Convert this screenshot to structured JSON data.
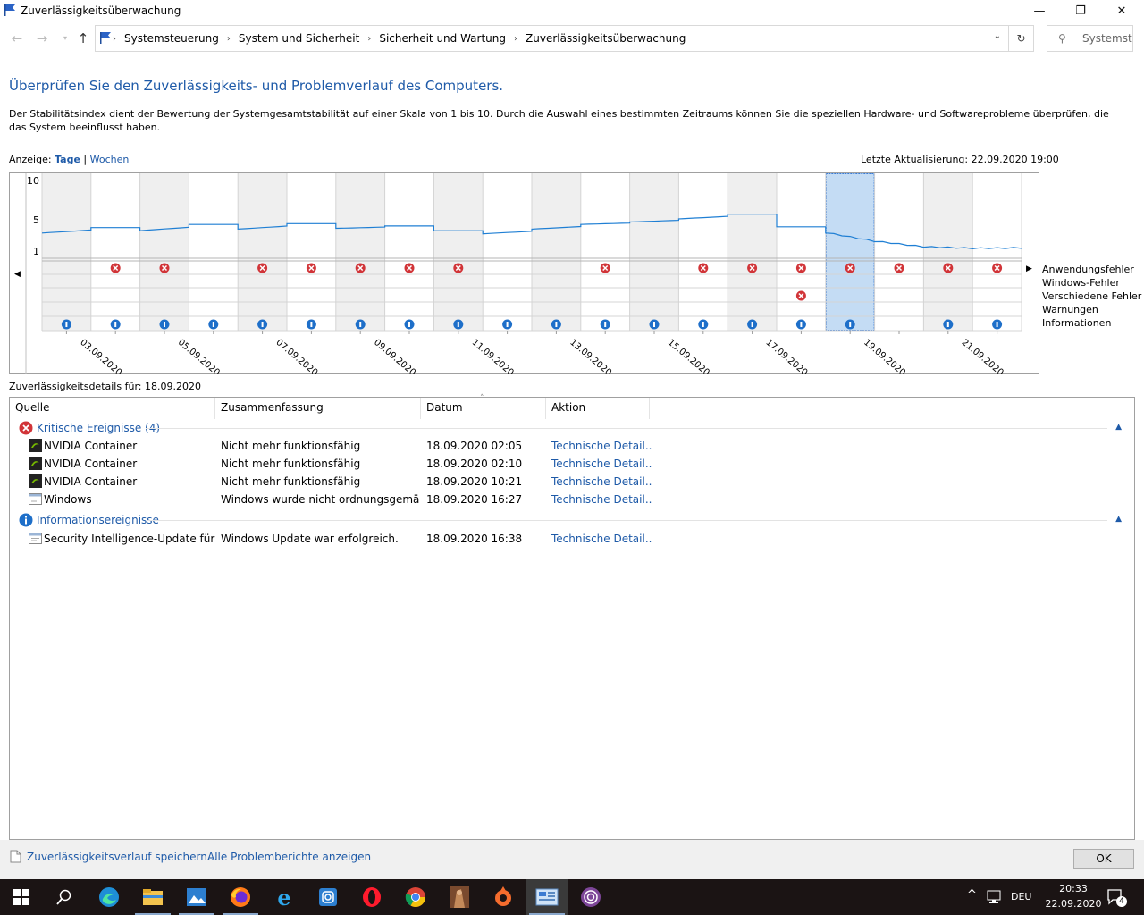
{
  "window": {
    "title": "Zuverlässigkeitsüberwachung",
    "minimize_glyph": "—",
    "restore_glyph": "❐",
    "close_glyph": "✕"
  },
  "address": {
    "breadcrumb": [
      "Systemsteuerung",
      "System und Sicherheit",
      "Sicherheit und Wartung",
      "Zuverlässigkeitsüberwachung"
    ],
    "search_placeholder": "Systemst..."
  },
  "main": {
    "heading": "Überprüfen Sie den Zuverlässigkeits- und Problemverlauf des Computers.",
    "description": "Der Stabilitätsindex dient der Bewertung der Systemgesamtstabilität auf einer Skala von 1 bis 10. Durch die Auswahl eines bestimmten Zeitraums können Sie die speziellen Hardware- und Softwareprobleme überprüfen, die das System beeinflusst haben.",
    "view_label": "Anzeige:",
    "view_days": "Tage",
    "view_sep": "|",
    "view_weeks": "Wochen",
    "last_update": "Letzte Aktualisierung: 22.09.2020 19:00"
  },
  "chart_data": {
    "type": "line",
    "y_ticks": [
      "10",
      "5",
      "1"
    ],
    "ylim": [
      1,
      10
    ],
    "x_labels": [
      "03.09.2020",
      "05.09.2020",
      "07.09.2020",
      "09.09.2020",
      "11.09.2020",
      "13.09.2020",
      "15.09.2020",
      "17.09.2020",
      "19.09.2020",
      "21.09.2020"
    ],
    "days": [
      "02.09",
      "03.09",
      "04.09",
      "05.09",
      "06.09",
      "07.09",
      "08.09",
      "09.09",
      "10.09",
      "11.09",
      "12.09",
      "13.09",
      "14.09",
      "15.09",
      "16.09",
      "17.09",
      "18.09",
      "19.09",
      "20.09",
      "21.09"
    ],
    "selected_day": "18.09",
    "stability_index": [
      3.3,
      4.0,
      3.6,
      4.4,
      3.8,
      4.5,
      3.9,
      4.2,
      3.6,
      3.2,
      3.8,
      4.4,
      4.7,
      5.1,
      5.7,
      4.1,
      3.3,
      2.2,
      1.5,
      1.3
    ],
    "rows": [
      "Anwendungsfehler",
      "Windows-Fehler",
      "Verschiedene Fehler",
      "Warnungen",
      "Informationen"
    ],
    "app_failures": [
      0,
      1,
      1,
      0,
      1,
      1,
      1,
      1,
      1,
      0,
      0,
      1,
      0,
      1,
      1,
      1,
      1,
      1,
      1,
      1
    ],
    "misc_failures": [
      0,
      0,
      0,
      0,
      0,
      0,
      0,
      0,
      0,
      0,
      0,
      0,
      0,
      0,
      0,
      1,
      0,
      0,
      0,
      0
    ],
    "information": [
      1,
      1,
      1,
      1,
      1,
      1,
      1,
      1,
      1,
      1,
      1,
      1,
      1,
      1,
      1,
      1,
      1,
      0,
      1,
      1
    ],
    "grid": true
  },
  "details": {
    "label": "Zuverlässigkeitsdetails für: 18.09.2020",
    "columns": [
      "Quelle",
      "Zusammenfassung",
      "Datum",
      "Aktion"
    ],
    "groups": [
      {
        "title": "Kritische Ereignisse (4)",
        "icon": "critical-icon",
        "rows": [
          {
            "icon": "nvidia-icon",
            "source": "NVIDIA Container",
            "summary": "Nicht mehr funktionsfähig",
            "date": "18.09.2020 02:05",
            "action": "Technische Detail..."
          },
          {
            "icon": "nvidia-icon",
            "source": "NVIDIA Container",
            "summary": "Nicht mehr funktionsfähig",
            "date": "18.09.2020 02:10",
            "action": "Technische Detail..."
          },
          {
            "icon": "nvidia-icon",
            "source": "NVIDIA Container",
            "summary": "Nicht mehr funktionsfähig",
            "date": "18.09.2020 10:21",
            "action": "Technische Detail..."
          },
          {
            "icon": "window-app-icon",
            "source": "Windows",
            "summary": "Windows wurde nicht ordnungsgemäß ...",
            "date": "18.09.2020 16:27",
            "action": "Technische Detail..."
          }
        ]
      },
      {
        "title": "Informationsereignisse",
        "icon": "info-icon",
        "rows": [
          {
            "icon": "window-app-icon",
            "source": "Security Intelligence-Update für M...",
            "summary": "Windows Update war erfolgreich.",
            "date": "18.09.2020 16:38",
            "action": "Technische Detail..."
          }
        ]
      }
    ]
  },
  "footer": {
    "save_link": "Zuverlässigkeitsverlauf speichern...",
    "reports_link": "Alle Problemberichte anzeigen",
    "ok": "OK"
  },
  "taskbar": {
    "apps": [
      "windows-start-icon",
      "search-icon",
      "edge-icon",
      "file-explorer-icon",
      "photos-icon",
      "firefox-icon",
      "internet-explorer-icon",
      "instagram-icon",
      "opera-icon",
      "chrome-icon",
      "game-icon",
      "origin-icon",
      "control-panel-icon",
      "tor-icon"
    ],
    "lang": "DEU",
    "time": "20:33",
    "date": "22.09.2020",
    "notifications": "4"
  }
}
